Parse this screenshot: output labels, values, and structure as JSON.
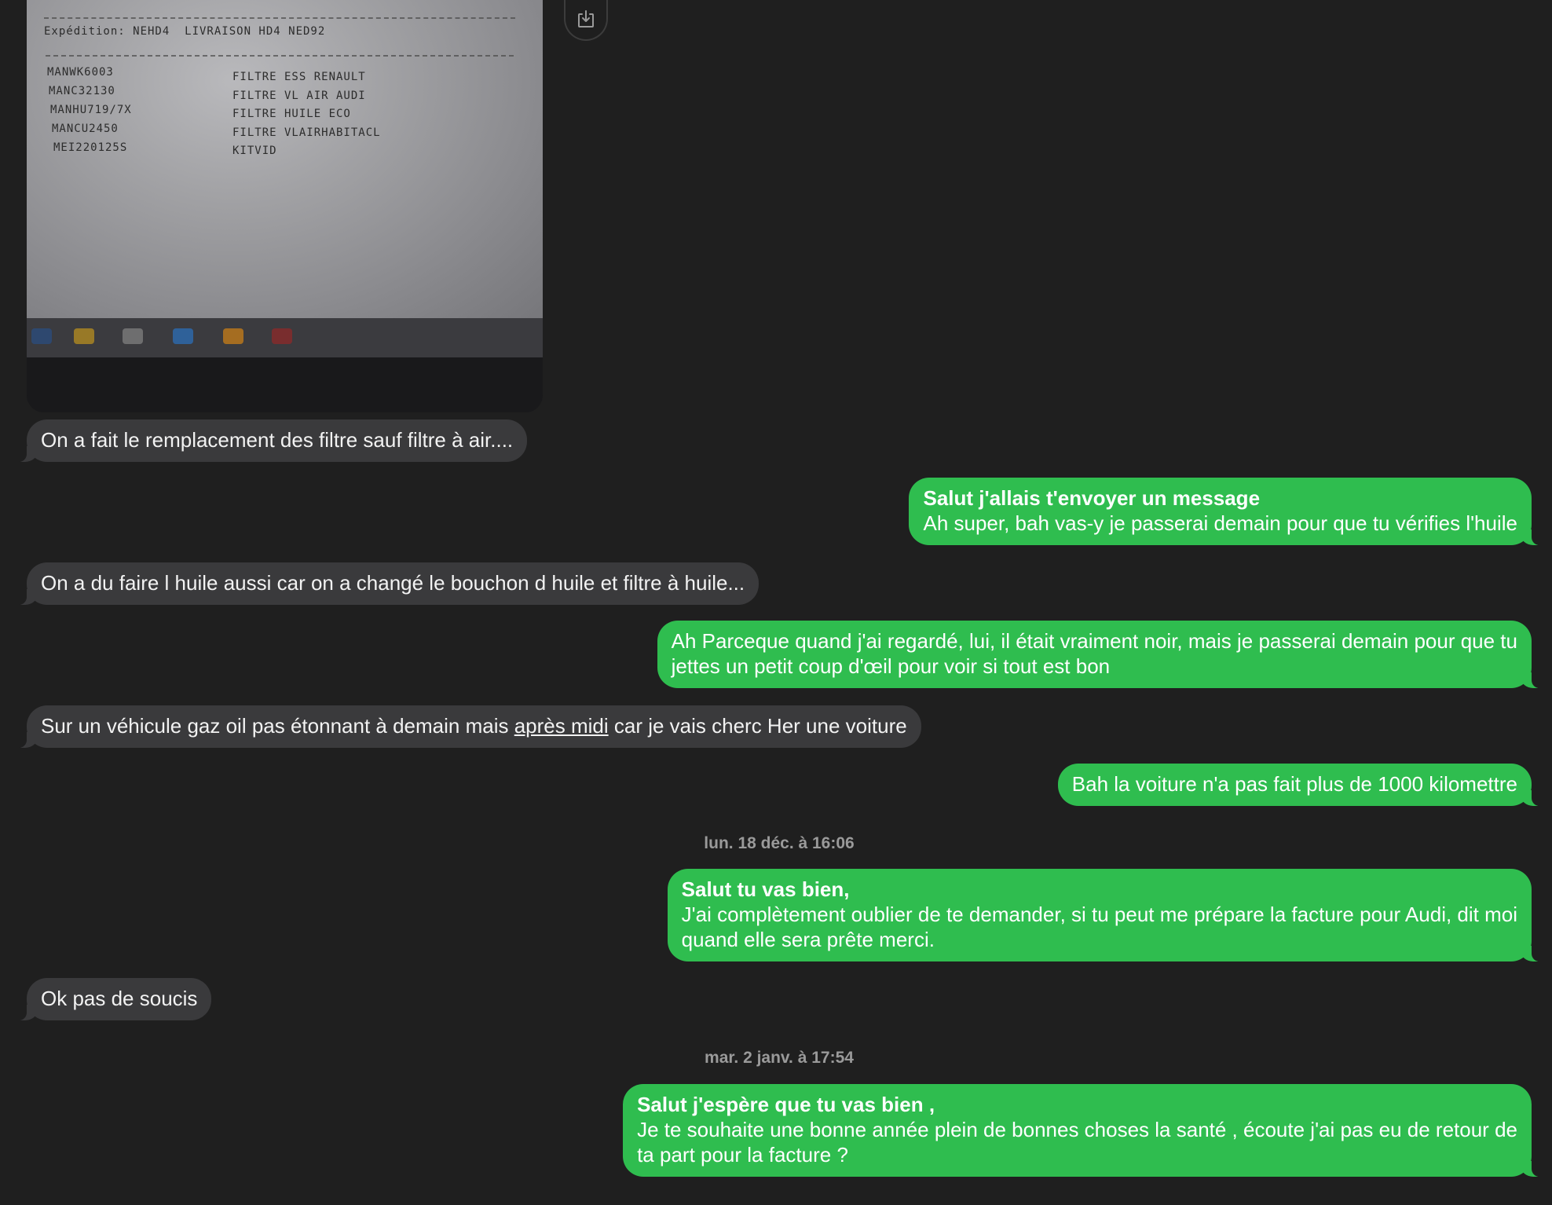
{
  "attachment": {
    "header_text": "Expédition: NEHD4  LIVRAISON HD4 NED92",
    "rows": [
      {
        "code": "MANWK6003",
        "desc": "FILTRE ESS RENAULT"
      },
      {
        "code": "MANC32130",
        "desc": "FILTRE VL AIR AUDI"
      },
      {
        "code": "MANHU719/7X",
        "desc": "FILTRE HUILE ECO"
      },
      {
        "code": "MANCU2450",
        "desc": "FILTRE VLAIRHABITACL"
      },
      {
        "code": "MEI220125S",
        "desc": "KITVID"
      }
    ],
    "download_icon": "download-icon"
  },
  "messages": [
    {
      "side": "received",
      "text": "On a fait le remplacement des filtre sauf filtre à air...."
    },
    {
      "side": "sent",
      "title": "Salut j'allais t'envoyer un message",
      "text": "Ah super, bah vas-y je passerai demain pour que tu vérifies l'huile"
    },
    {
      "side": "received",
      "text": "On a du faire l huile aussi car on a changé le bouchon d huile et filtre à huile..."
    },
    {
      "side": "sent",
      "line1": "Ah Parceque quand j'ai regardé, lui, il était vraiment noir, mais je passerai demain pour que tu",
      "line2": "jettes un petit coup d'œil pour voir si tout est bon"
    },
    {
      "side": "received",
      "before": "Sur un véhicule gaz oil pas étonnant  à demain mais ",
      "link": "après midi",
      "after": " car je vais cherc Her une voiture"
    },
    {
      "side": "sent",
      "text": "Bah la voiture n'a pas fait plus de 1000 kilomettre"
    },
    {
      "side": "sent",
      "title": "Salut tu vas bien,",
      "line1": "J'ai complètement oublier de te demander, si tu peut me prépare la facture pour Audi, dit moi",
      "line2": "quand elle sera prête merci."
    },
    {
      "side": "received",
      "text": "Ok pas de soucis"
    },
    {
      "side": "sent",
      "title": "Salut j'espère que tu vas bien ,",
      "line1": "Je te souhaite une bonne année plein de bonnes choses la santé , écoute j'ai pas eu de retour de",
      "line2": "ta part pour la facture ?"
    }
  ],
  "timestamps": [
    "lun. 18 déc. à 16:06",
    "mar. 2 janv. à 17:54"
  ]
}
